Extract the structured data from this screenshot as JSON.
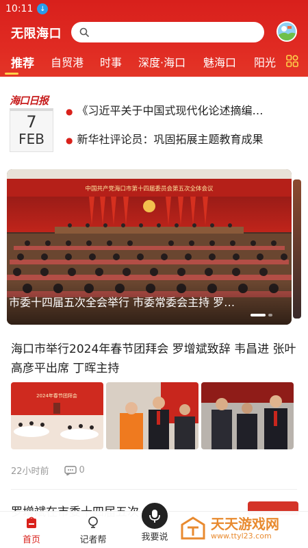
{
  "status_bar": {
    "time": "10:11"
  },
  "header": {
    "brand": "无限海口",
    "search": {
      "placeholder": ""
    },
    "tabs": [
      {
        "label": "推荐",
        "active": true
      },
      {
        "label": "自贸港"
      },
      {
        "label": "时事"
      },
      {
        "label": "深度·海口"
      },
      {
        "label": "魅海口"
      },
      {
        "label": "阳光"
      }
    ]
  },
  "daily": {
    "logo": "海口日报",
    "calendar": {
      "day": "7",
      "month": "FEB"
    },
    "items": [
      "《习近平关于中国式现代化论述摘编…",
      "新华社评论员：巩固拓展主题教育成果"
    ]
  },
  "carousel": {
    "caption": "市委十四届五次全会举行 市委常委会主持 罗…",
    "banner_text": "中国共产党海口市第十四届委员会第五次全体会议",
    "slide_count": 2,
    "active_slide": 1
  },
  "news": {
    "title": "海口市举行2024年春节团拜会 罗增斌致辞 韦昌进 张叶高彦平出席 丁晖主持",
    "thumb_banner": "2024年春节团拜会",
    "time_ago": "22小时前",
    "comments": "0"
  },
  "next_news": {
    "title": "罗增斌在市委十四届五次"
  },
  "bottom_nav": [
    {
      "label": "首页",
      "icon": "home-icon",
      "active": true
    },
    {
      "label": "记者帮",
      "icon": "lightbulb-icon"
    },
    {
      "label": "我要说",
      "icon": "microphone-icon"
    }
  ],
  "watermark": {
    "name": "天天游戏网",
    "url": "www.ttyl23.com"
  },
  "colors": {
    "brand_red": "#d9211b",
    "accent_yellow": "#ffd24a",
    "watermark_orange": "#e88a2f"
  }
}
